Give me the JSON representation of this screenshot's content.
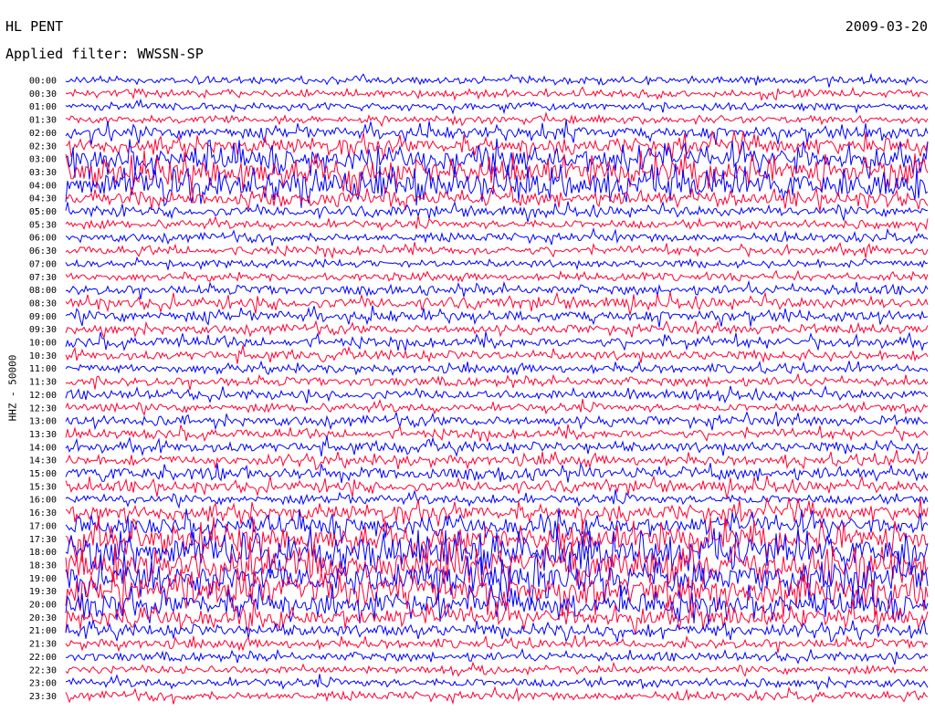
{
  "header": {
    "station": "HL PENT",
    "date": "2009-03-20",
    "filter_label": "Applied filter: WWSSN-SP"
  },
  "channel_label": "HHZ - 50000",
  "colors": {
    "trace_a": "#0000ff",
    "trace_b": "#ff0033"
  },
  "chart_data": {
    "type": "line",
    "title": "HL PENT",
    "subtitle": "Applied filter: WWSSN-SP",
    "ylabel": "HHZ - 50000",
    "date": "2009-03-20",
    "row_labels": [
      "00:00",
      "00:30",
      "01:00",
      "01:30",
      "02:00",
      "02:30",
      "03:00",
      "03:30",
      "04:00",
      "04:30",
      "05:00",
      "05:30",
      "06:00",
      "06:30",
      "07:00",
      "07:30",
      "08:00",
      "08:30",
      "09:00",
      "09:30",
      "10:00",
      "10:30",
      "11:00",
      "11:30",
      "12:00",
      "12:30",
      "13:00",
      "13:30",
      "14:00",
      "14:30",
      "15:00",
      "15:30",
      "16:00",
      "16:30",
      "17:00",
      "17:30",
      "18:00",
      "18:30",
      "19:00",
      "19:30",
      "20:00",
      "20:30",
      "21:00",
      "21:30",
      "22:00",
      "22:30",
      "23:00",
      "23:30"
    ],
    "row_minutes": 30,
    "series_colors": [
      "blue",
      "red"
    ],
    "row_amplitude_relative": [
      0.2,
      0.25,
      0.2,
      0.2,
      0.5,
      0.6,
      0.8,
      0.9,
      0.9,
      0.6,
      0.4,
      0.3,
      0.3,
      0.3,
      0.2,
      0.2,
      0.35,
      0.45,
      0.45,
      0.35,
      0.4,
      0.35,
      0.3,
      0.3,
      0.35,
      0.3,
      0.4,
      0.35,
      0.4,
      0.4,
      0.5,
      0.45,
      0.35,
      0.6,
      0.7,
      0.9,
      1.0,
      1.0,
      1.0,
      1.0,
      0.8,
      0.7,
      0.5,
      0.35,
      0.3,
      0.25,
      0.3,
      0.3
    ],
    "grid": false
  }
}
